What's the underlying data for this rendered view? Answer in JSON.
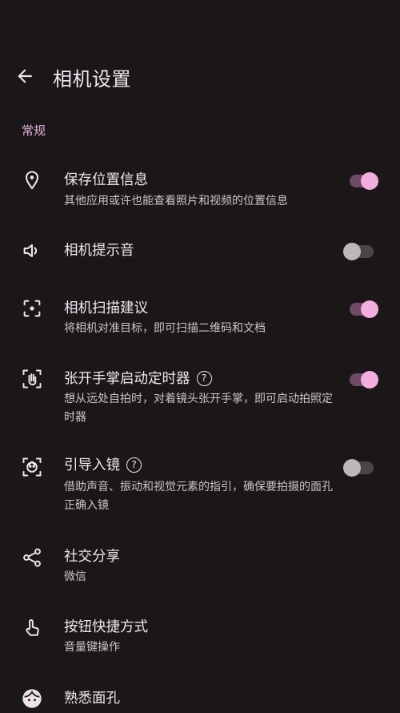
{
  "header": {
    "title": "相机设置",
    "back_icon": "arrow-back-icon"
  },
  "section_title": "常规",
  "colors": {
    "accent": "#f3aedf",
    "background": "#1b1719",
    "section": "#e3b2d9"
  },
  "settings": [
    {
      "icon": "location-pin-icon",
      "title": "保存位置信息",
      "subtitle": "其他应用或许也能查看照片和视频的位置信息",
      "toggle": true
    },
    {
      "icon": "volume-icon",
      "title": "相机提示音",
      "toggle": false
    },
    {
      "icon": "scan-icon",
      "title": "相机扫描建议",
      "subtitle": "将相机对准目标，即可扫描二维码和文档",
      "toggle": true
    },
    {
      "icon": "palm-icon",
      "title": "张开手掌启动定时器",
      "help": "?",
      "subtitle": "想从远处自拍时，对着镜头张开手掌，即可启动拍照定时器",
      "toggle": true
    },
    {
      "icon": "face-frame-icon",
      "title": "引导入镜",
      "help": "?",
      "subtitle": "借助声音、振动和视觉元素的指引，确保要拍摄的面孔正确入镜",
      "toggle": false
    },
    {
      "icon": "share-icon",
      "title": "社交分享",
      "subtitle": "微信"
    },
    {
      "icon": "touch-icon",
      "title": "按钮快捷方式",
      "subtitle": "音量键操作"
    },
    {
      "icon": "face-icon",
      "title": "熟悉面孔"
    }
  ]
}
